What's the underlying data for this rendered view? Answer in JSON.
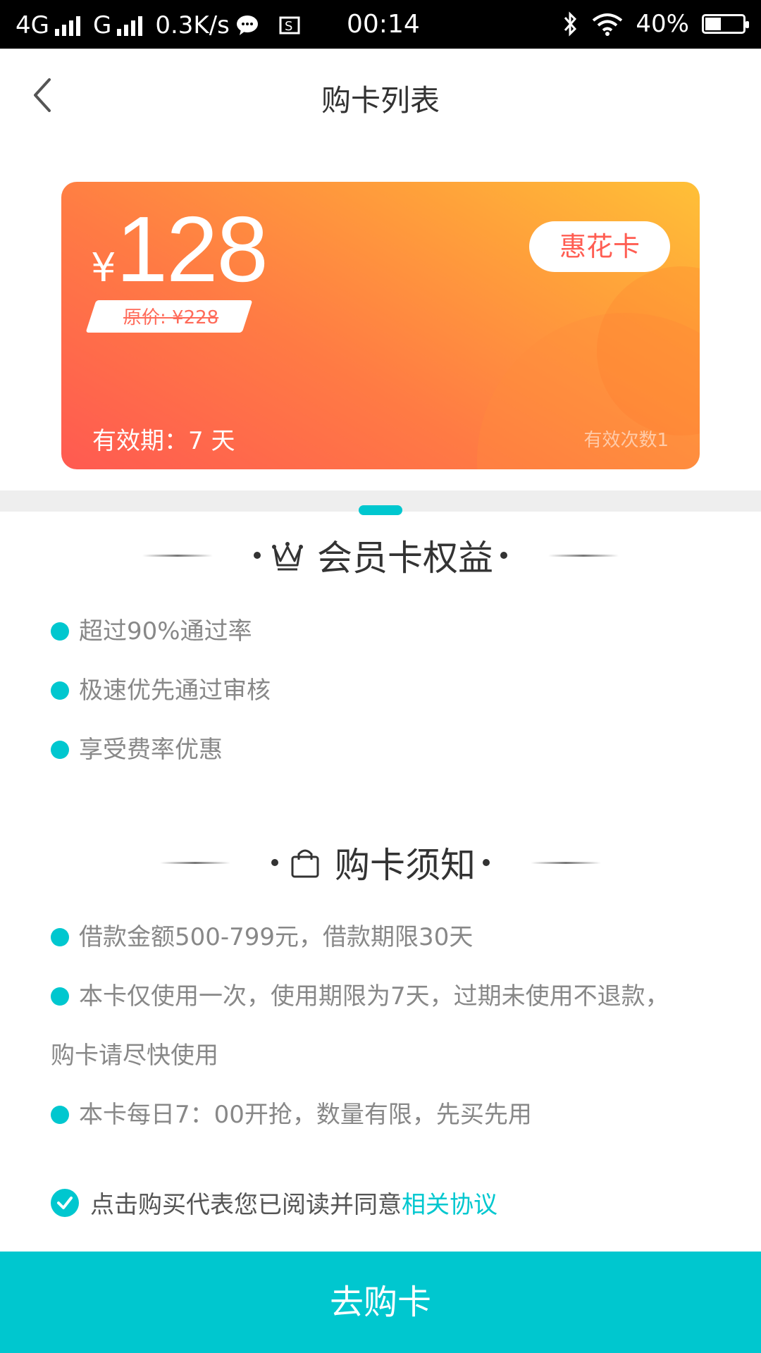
{
  "status_bar": {
    "network1": "4G",
    "network2": "G",
    "speed": "0.3K/s",
    "time": "00:14",
    "battery": "40%"
  },
  "header": {
    "title": "购卡列表"
  },
  "card": {
    "currency": "¥",
    "price": "128",
    "original_price": "原价: ¥228",
    "badge": "惠花卡",
    "validity": "有效期：7 天",
    "times": "有效次数1"
  },
  "benefits": {
    "title": "会员卡权益",
    "items": [
      "超过90%通过率",
      "极速优先通过审核",
      "享受费率优惠"
    ]
  },
  "notice": {
    "title": "购卡须知",
    "items": [
      "借款金额500-799元，借款期限30天",
      "本卡仅使用一次，使用期限为7天，过期未使用不退款，",
      "购卡请尽快使用",
      "本卡每日7：00开抢，数量有限，先买先用"
    ]
  },
  "agreement": {
    "text": "点击购买代表您已阅读并同意",
    "link": "相关协议"
  },
  "buy_button": "去购卡",
  "colors": {
    "accent": "#00c7cf",
    "card_start": "#ff5a51",
    "card_end": "#ffc037"
  }
}
